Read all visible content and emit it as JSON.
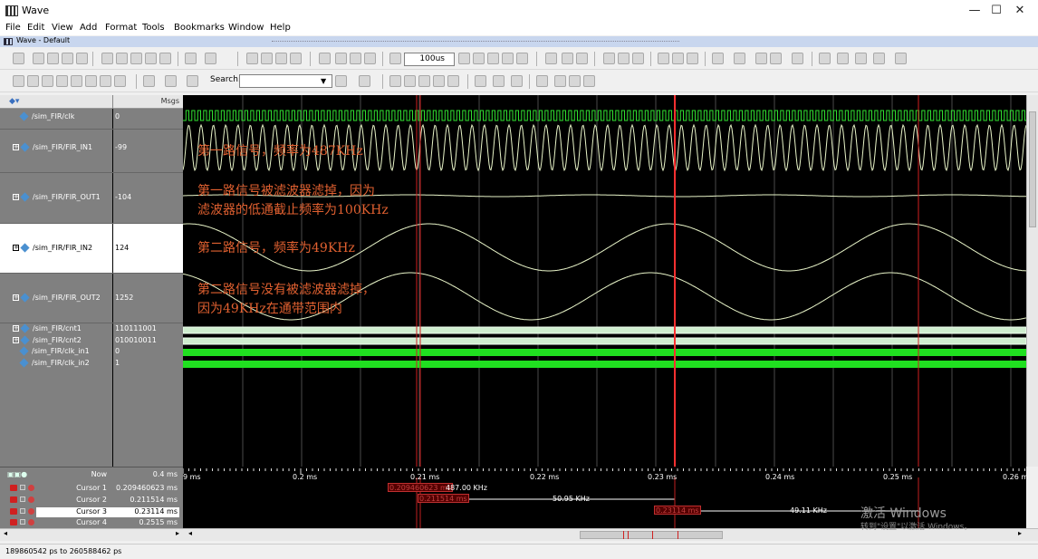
{
  "window": {
    "title": "Wave",
    "minimize": "—",
    "maximize": "☐",
    "close": "✕"
  },
  "menu": [
    "File",
    "Edit",
    "View",
    "Add",
    "Format",
    "Tools",
    "Bookmarks",
    "Window",
    "Help"
  ],
  "subwindow_title": "Wave - Default",
  "toolbar": {
    "time_value": "100us",
    "search_label": "Search:",
    "search_value": ""
  },
  "columns": {
    "msgs": "Msgs"
  },
  "signals": [
    {
      "name": "/sim_FIR/clk",
      "value": "0"
    },
    {
      "name": "/sim_FIR/FIR_IN1",
      "value": "-99"
    },
    {
      "name": "/sim_FIR/FIR_OUT1",
      "value": "-104"
    },
    {
      "name": "/sim_FIR/FIR_IN2",
      "value": "124"
    },
    {
      "name": "/sim_FIR/FIR_OUT2",
      "value": "1252"
    },
    {
      "name": "/sim_FIR/cnt1",
      "value": "110111001"
    },
    {
      "name": "/sim_FIR/cnt2",
      "value": "010010011"
    },
    {
      "name": "/sim_FIR/clk_in1",
      "value": "0"
    },
    {
      "name": "/sim_FIR/clk_in2",
      "value": "1"
    }
  ],
  "annotations": [
    "第一路信号，频率为487KHz",
    "第一路信号被滤波器滤掉，因为",
    "滤波器的低通截止频率为100KHz",
    "第二路信号，频率为49KHz",
    "第二路信号没有被滤波器滤掉，",
    "因为49KHz在通带范围内"
  ],
  "cursors": {
    "now": {
      "label": "Now",
      "value": "0.4 ms"
    },
    "list": [
      {
        "label": "Cursor 1",
        "value": "0.209460623 ms"
      },
      {
        "label": "Cursor 2",
        "value": "0.211514 ms"
      },
      {
        "label": "Cursor 3",
        "value": "0.23114 ms"
      },
      {
        "label": "Cursor 4",
        "value": "0.2515 ms"
      }
    ]
  },
  "timeline": {
    "ticks": [
      "0.2 ms",
      "0.21 ms",
      "0.22 ms",
      "0.23 ms",
      "0.24 ms",
      "0.25 ms"
    ],
    "left_edge": "9 ms",
    "right_edge": "0.26 m",
    "cursor_tags": [
      "0.209460623 ms",
      "0.211514 ms",
      "0.23114 ms"
    ],
    "deltas": [
      "487.00 KHz",
      "50.95 KHz",
      "49.11 KHz"
    ]
  },
  "status": "189860542 ps to 260588462 ps",
  "watermark": [
    "激活 Windows",
    "转到\"设置\"以激活 Windows。"
  ]
}
